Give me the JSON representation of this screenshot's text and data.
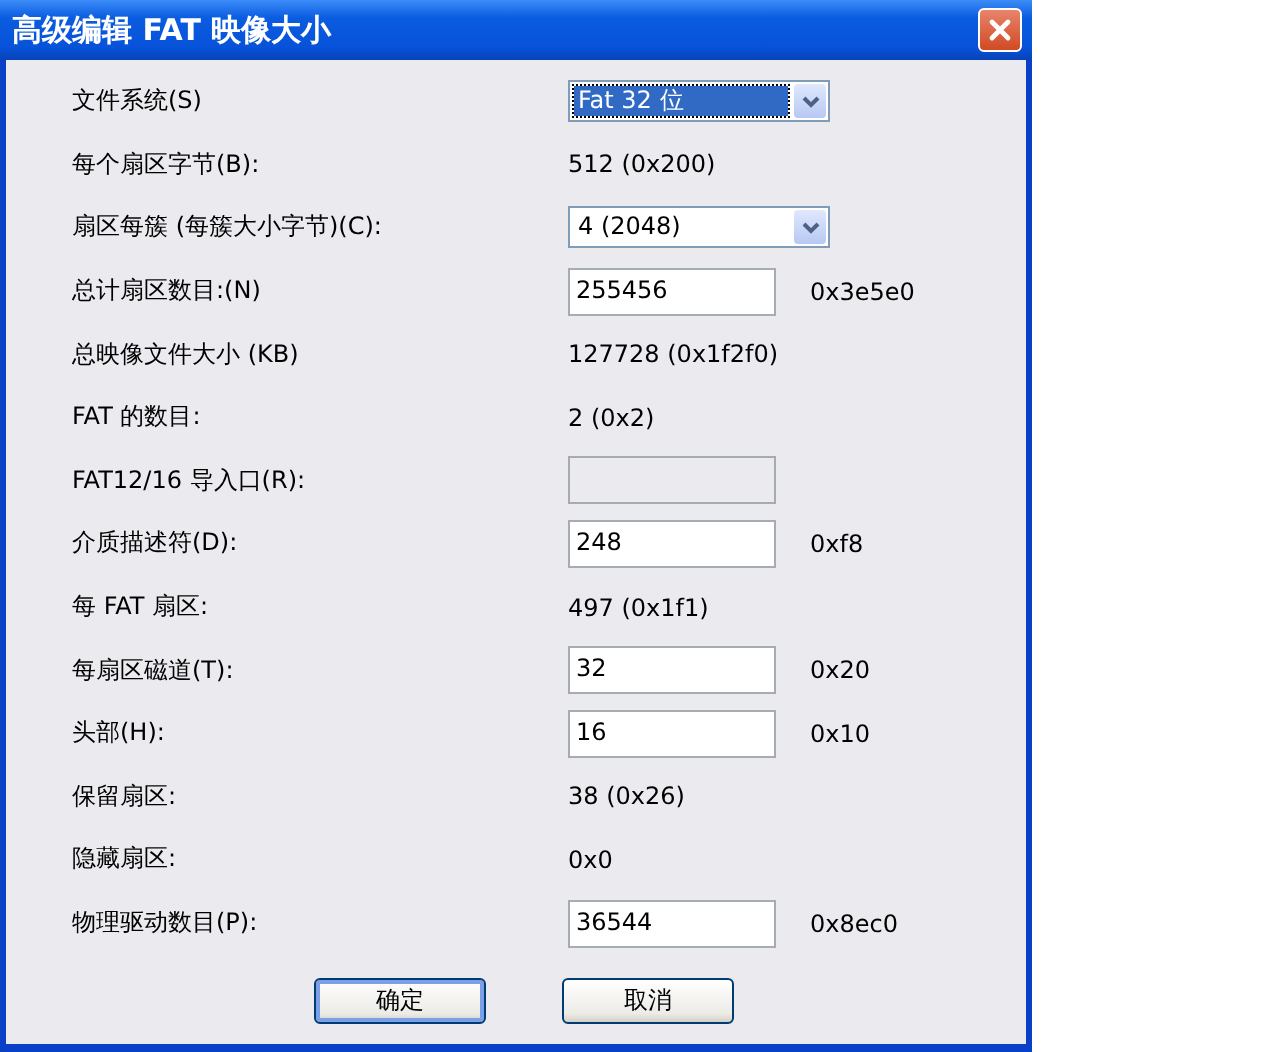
{
  "window": {
    "title": "高级编辑 FAT 映像大小"
  },
  "rows": [
    {
      "kind": "dropdown",
      "label": "文件系统(S)",
      "value": "Fat 32 位",
      "highlighted": true
    },
    {
      "kind": "text",
      "label": "每个扇区字节(B):",
      "value": "512 (0x200)"
    },
    {
      "kind": "dropdown",
      "label": "扇区每簇 (每簇大小字节)(C):",
      "value": "4 (2048)",
      "highlighted": false
    },
    {
      "kind": "input",
      "label": "总计扇区数目:(N)",
      "value": "255456",
      "hex": "0x3e5e0"
    },
    {
      "kind": "text",
      "label": "总映像文件大小 (KB)",
      "value": "127728 (0x1f2f0)"
    },
    {
      "kind": "text",
      "label": "FAT 的数目:",
      "value": "2 (0x2)"
    },
    {
      "kind": "input",
      "label": "FAT12/16 导入口(R):",
      "disabled": true
    },
    {
      "kind": "input",
      "label": "介质描述符(D):",
      "value": "248",
      "hex": "0xf8"
    },
    {
      "kind": "text",
      "label": "每 FAT 扇区:",
      "value": "497 (0x1f1)"
    },
    {
      "kind": "input",
      "label": "每扇区磁道(T):",
      "value": "32",
      "hex": "0x20"
    },
    {
      "kind": "input",
      "label": "头部(H):",
      "value": "16",
      "hex": "0x10"
    },
    {
      "kind": "text",
      "label": "保留扇区:",
      "value": "38 (0x26)"
    },
    {
      "kind": "text",
      "label": "隐藏扇区:",
      "value": "0x0"
    },
    {
      "kind": "input",
      "label": "物理驱动数目(P):",
      "value": "36544",
      "hex": "0x8ec0"
    }
  ],
  "buttons": [
    {
      "label": "确定",
      "default": true
    },
    {
      "label": "取消",
      "default": false
    }
  ]
}
